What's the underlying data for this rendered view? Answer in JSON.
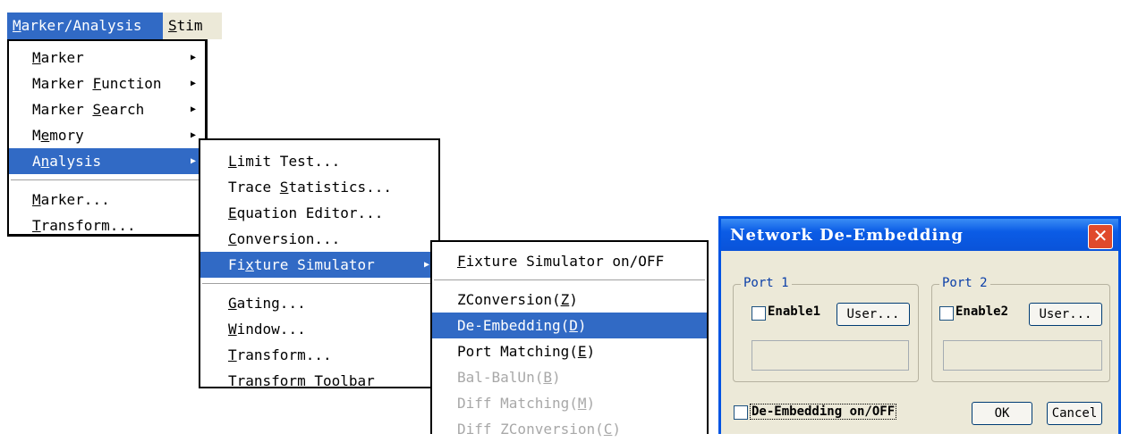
{
  "menubar": {
    "items": [
      {
        "label": "Marker/Analysis",
        "active": true
      },
      {
        "label": "Stim",
        "active": false
      }
    ]
  },
  "menu_marker_analysis": {
    "items": [
      "Marker",
      "Marker Function",
      "Marker Search",
      "Memory",
      "Analysis",
      "Marker...",
      "Transform..."
    ]
  },
  "menu_analysis": {
    "items": [
      "Limit Test...",
      "Trace Statistics...",
      "Equation Editor...",
      "Conversion...",
      "Fixture Simulator",
      "Gating...",
      "Window...",
      "Transform...",
      "Transform Toolbar"
    ]
  },
  "menu_fixture": {
    "items": [
      "Fixture Simulator on/OFF",
      "ZConversion(Z)",
      "De-Embedding(D)",
      "Port Matching(E)",
      "Bal-BalUn(B)",
      "Diff Matching(M)",
      "Diff ZConversion(C)"
    ]
  },
  "dialog": {
    "title": "Network De-Embedding",
    "port1": {
      "label": "Port 1",
      "enable_label": "Enable1",
      "user_button": "User...",
      "enabled": false
    },
    "port2": {
      "label": "Port 2",
      "enable_label": "Enable2",
      "user_button": "User...",
      "enabled": false
    },
    "deembed_label": "De-Embedding on/OFF",
    "deembed_checked": false,
    "ok_button": "OK",
    "cancel_button": "Cancel"
  },
  "colors": {
    "highlight": "#316ac5",
    "titlebar": "#0a53d9",
    "dialog_bg": "#ece9d8",
    "disabled_text": "#a8a8a8"
  }
}
